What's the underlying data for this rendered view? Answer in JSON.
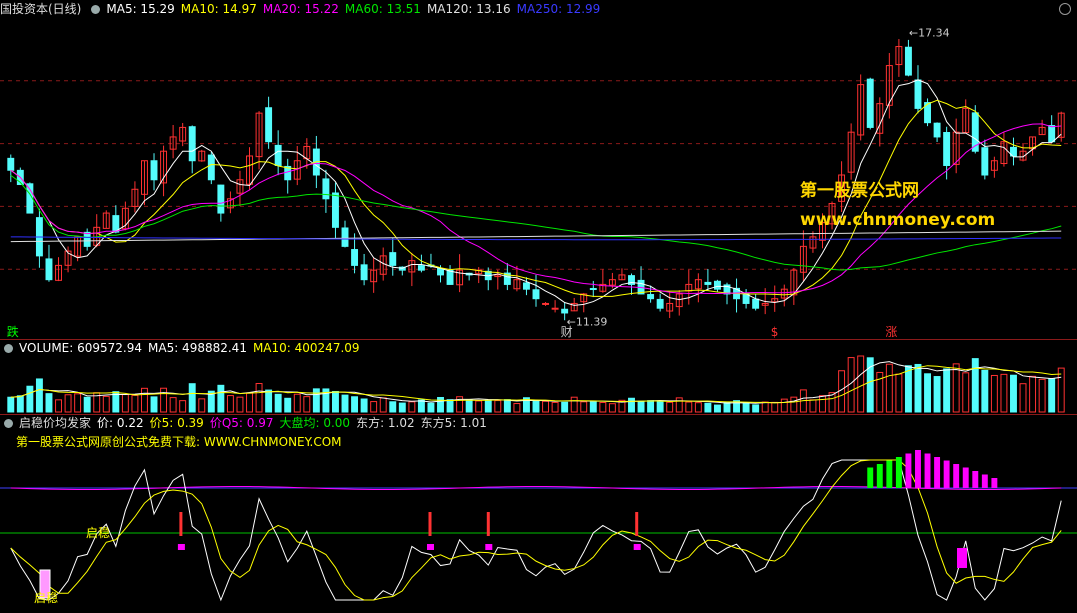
{
  "header1": {
    "stock": "国投资本(日线)",
    "ma5": "MA5: 15.29",
    "ma10": "MA10: 14.97",
    "ma20": "MA20: 15.22",
    "ma60": "MA60: 13.51",
    "ma120": "MA120: 13.16",
    "ma250": "MA250: 12.99"
  },
  "header2": {
    "volume": "VOLUME: 609572.94",
    "ma5": "MA5: 498882.41",
    "ma10": "MA10: 400247.09"
  },
  "header3": {
    "name": "启稳价均发家",
    "jia": "价: 0.22",
    "jia5": "价5: 0.39",
    "jiaq5": "价Q5: 0.97",
    "dapan": "大盘均: 0.00",
    "dongfang": "东方: 1.02",
    "dongfang5": "东方5: 1.01"
  },
  "promo_line": "第一股票公式网原创公式免费下载: WWW.CHNMONEY.COM",
  "watermark": {
    "line1": "第一股票公式网",
    "line2": "www.chnmoney.com"
  },
  "labels": {
    "high": "17.34",
    "low": "11.39",
    "die": "跌",
    "cai": "财",
    "s": "$",
    "zhang": "涨",
    "qiwen1": "启稳",
    "qiwen2": "启稳"
  },
  "colors": {
    "up": "#ff3232",
    "down": "#54fcfc",
    "ma5": "#ffffff",
    "ma10": "#ffff00",
    "ma20": "#ff00ff",
    "ma60": "#00e600",
    "ma120": "#e0e0e0",
    "ma250": "#3030ff",
    "grid": "#8b1a1a"
  },
  "chart_data": {
    "type": "candlestick",
    "closes": [
      14.4,
      14.1,
      13.5,
      12.6,
      12.1,
      12.4,
      12.7,
      13.0,
      12.8,
      13.2,
      13.5,
      13.1,
      13.6,
      14.0,
      14.6,
      14.2,
      14.8,
      15.1,
      15.3,
      14.6,
      14.8,
      14.2,
      13.5,
      13.8,
      14.2,
      14.7,
      15.6,
      15.0,
      14.5,
      14.2,
      14.6,
      14.9,
      14.3,
      13.8,
      13.2,
      12.8,
      12.4,
      12.1,
      12.3,
      12.6,
      12.4,
      12.3,
      12.5,
      12.3,
      12.4,
      12.2,
      12.0,
      12.3,
      12.2,
      12.3,
      12.1,
      12.2,
      12.0,
      12.1,
      11.9,
      11.7,
      11.6,
      11.5,
      11.4,
      11.6,
      11.8,
      11.9,
      12.0,
      12.1,
      12.2,
      12.0,
      11.8,
      11.7,
      11.5,
      11.6,
      11.8,
      12.0,
      12.1,
      12.0,
      11.9,
      11.8,
      11.7,
      11.6,
      11.5,
      11.6,
      11.7,
      11.9,
      12.3,
      12.8,
      13.0,
      13.3,
      13.7,
      14.3,
      15.2,
      16.2,
      15.3,
      15.8,
      16.6,
      17.0,
      16.4,
      15.7,
      15.4,
      15.1,
      14.5,
      15.2,
      15.7,
      14.8,
      14.3,
      14.6,
      15.0,
      14.7,
      14.8,
      15.1,
      15.3,
      15.0,
      15.6
    ],
    "ylim": [
      11.0,
      17.6
    ],
    "high_marker": 17.34,
    "low_marker": 11.39,
    "volume": {
      "last": 609572.94,
      "ma5": 498882.41,
      "ma10": 400247.09
    },
    "indicator": {
      "jia": 0.22,
      "jia5": 0.39,
      "jiaq5": 0.97,
      "dapan": 0.0,
      "dongfang": 1.02,
      "dongfang5": 1.01
    }
  }
}
